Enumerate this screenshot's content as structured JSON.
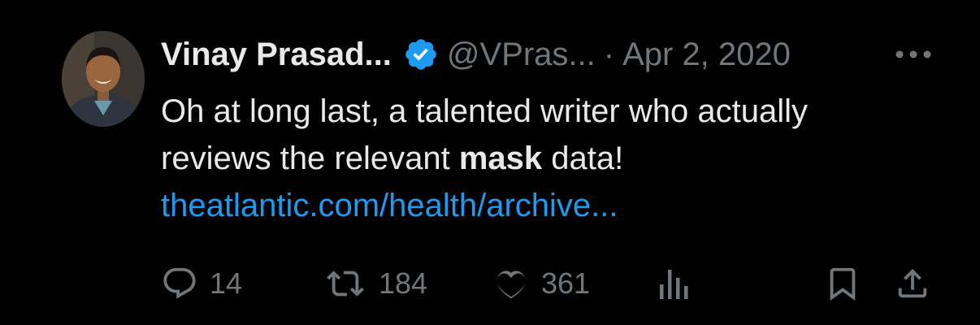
{
  "tweet": {
    "author_name": "Vinay Prasad...",
    "handle": "@VPras...",
    "separator": "·",
    "date": "Apr 2, 2020",
    "text_line1": "Oh at long last, a talented writer who actually",
    "text_line2_before": "reviews the relevant ",
    "text_line2_bold": "mask",
    "text_line2_after": " data!",
    "link": "theatlantic.com/health/archive..."
  },
  "actions": {
    "replies": "14",
    "retweets": "184",
    "likes": "361"
  },
  "colors": {
    "background": "#000000",
    "primary_text": "#e7e9ea",
    "secondary_text": "#71767b",
    "accent_blue": "#1d9bf0"
  },
  "icons": [
    "verified-badge-icon",
    "more-icon",
    "reply-icon",
    "retweet-icon",
    "like-icon",
    "views-icon",
    "bookmark-icon",
    "share-icon"
  ]
}
